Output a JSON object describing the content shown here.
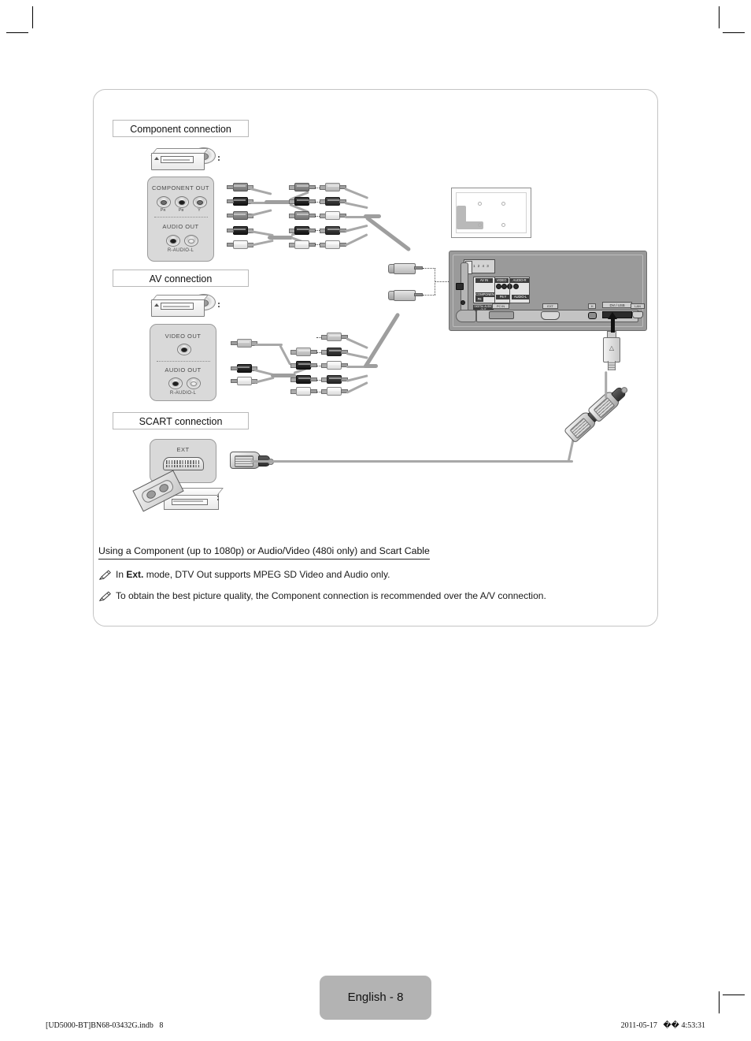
{
  "page": {
    "badge_label": "English - 8",
    "footer_left": "[UD5000-BT]BN68-03432G.indb   8",
    "footer_right": "2011-05-17   �� 4:53:31"
  },
  "sections": {
    "component": {
      "title": "Component connection",
      "panel": {
        "out_label": "COMPONENT OUT",
        "jacks": [
          "Pʀ",
          "Pʙ",
          "Y"
        ],
        "audio_label": "AUDIO OUT",
        "audio_caption": "R-AUDIO-L"
      }
    },
    "av": {
      "title": "AV connection",
      "panel": {
        "video_label": "VIDEO OUT",
        "audio_label": "AUDIO OUT",
        "audio_caption": "R-AUDIO-L"
      }
    },
    "scart": {
      "title": "SCART connection",
      "panel": {
        "ext_label": "EXT"
      }
    }
  },
  "tv": {
    "hdmi_label": "1 2 4 3",
    "ports": {
      "av_in": "AV IN",
      "video": "VIDEO",
      "audio_r": "AUDIO-R",
      "component": "COMPONENT",
      "pr": "Pʀ",
      "pb_y": "Pʙ Y",
      "audio_l": "AUDIO-L",
      "digital_audio_out": "DIGITAL AUDIO OUT",
      "pc_in": "PC IN",
      "antenna": "ANT IN",
      "usb": "USB",
      "headphone": "H",
      "ext": "EXT",
      "dvi_usb": "DVI / USB",
      "lan": "LAN"
    }
  },
  "notes": {
    "heading": "Using a Component (up to 1080p) or Audio/Video (480i only) and Scart Cable",
    "items": [
      {
        "pre": "In ",
        "bold": "Ext.",
        "post": " mode, DTV Out supports MPEG SD Video and Audio only."
      },
      {
        "pre": "",
        "bold": "",
        "post": "To obtain the best picture quality, the Component connection is recommended over the A/V connection."
      }
    ]
  },
  "icons": {
    "note": "pencil-note-icon"
  }
}
